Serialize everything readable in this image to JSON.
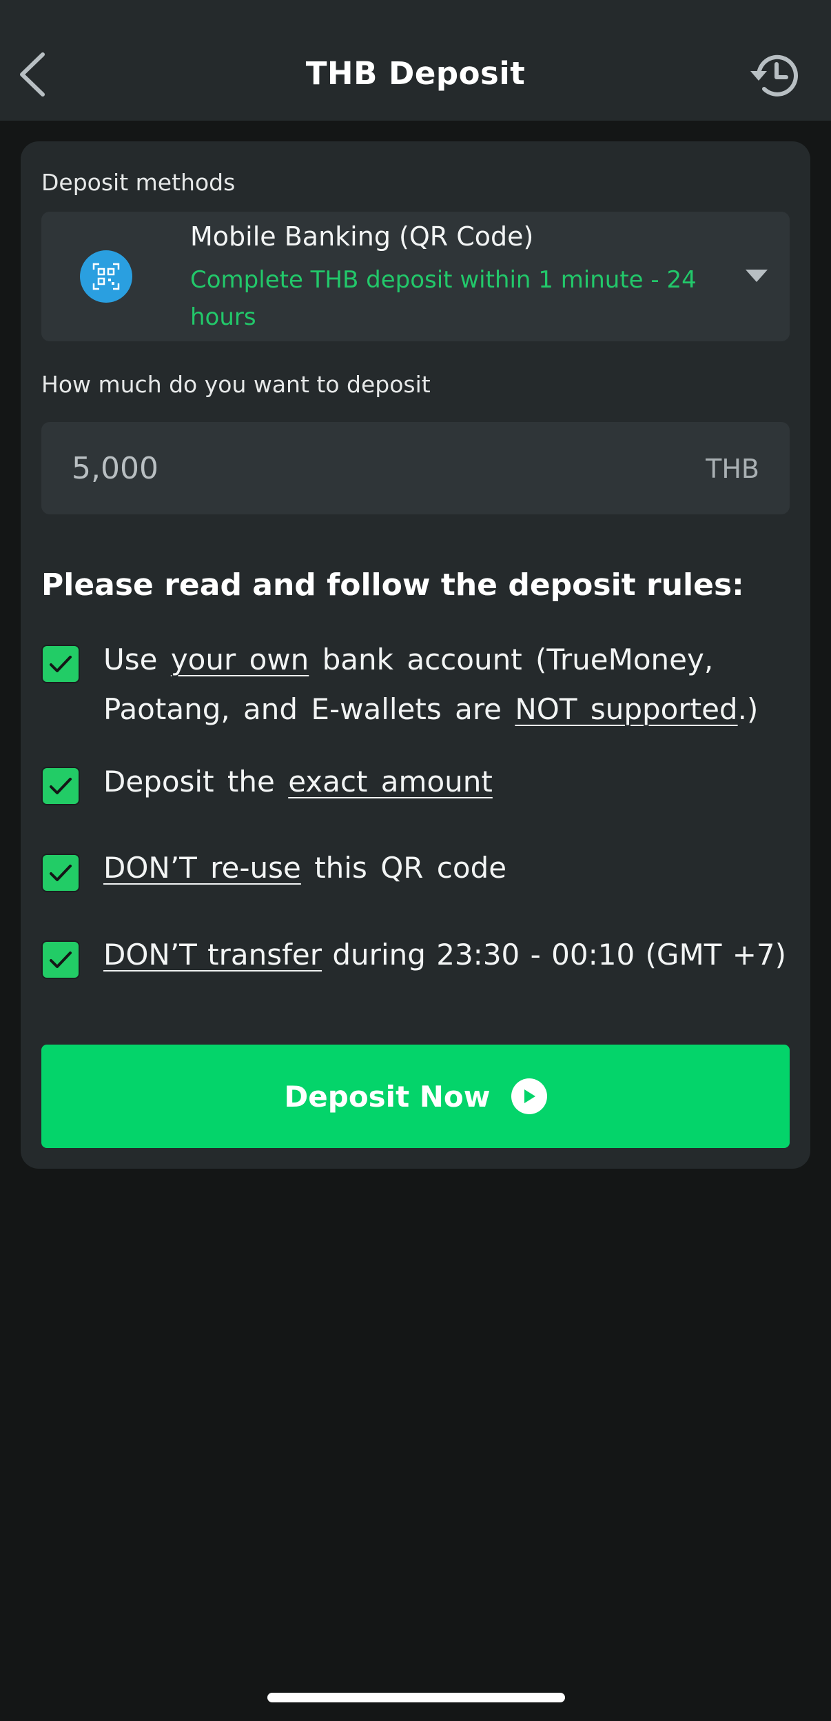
{
  "header": {
    "title": "THB Deposit",
    "back_icon": "chevron-left-icon",
    "history_icon": "history-clock-icon"
  },
  "deposit_methods": {
    "label": "Deposit methods",
    "selected": {
      "name": "Mobile Banking (QR Code)",
      "subtitle": "Complete THB deposit within 1 minute - 24 hours",
      "icon": "qr-code-icon"
    }
  },
  "amount": {
    "label": "How much do you want to deposit",
    "placeholder": "5,000",
    "currency": "THB"
  },
  "rules": {
    "title": "Please read and follow the deposit rules:",
    "items": [
      {
        "checked": true,
        "parts": [
          "Use ",
          "your own",
          " bank account (TrueMoney, Paotang, and E-wallets are ",
          "NOT supported",
          ".)"
        ]
      },
      {
        "checked": true,
        "parts": [
          "Deposit the ",
          "exact amount"
        ]
      },
      {
        "checked": true,
        "parts": [
          "DON’T re-use",
          " this QR code"
        ]
      },
      {
        "checked": true,
        "parts": [
          "DON’T transfer",
          " during 23:30 - 00:10 (GMT +7)"
        ]
      }
    ]
  },
  "action": {
    "label": "Deposit Now",
    "icon": "play-circle-icon"
  },
  "colors": {
    "accent": "#04D46A",
    "subtitle_green": "#22C86A",
    "background": "#141616",
    "card": "#252A2C",
    "field": "#2F3538",
    "qr_badge": "#2A9FE0"
  }
}
